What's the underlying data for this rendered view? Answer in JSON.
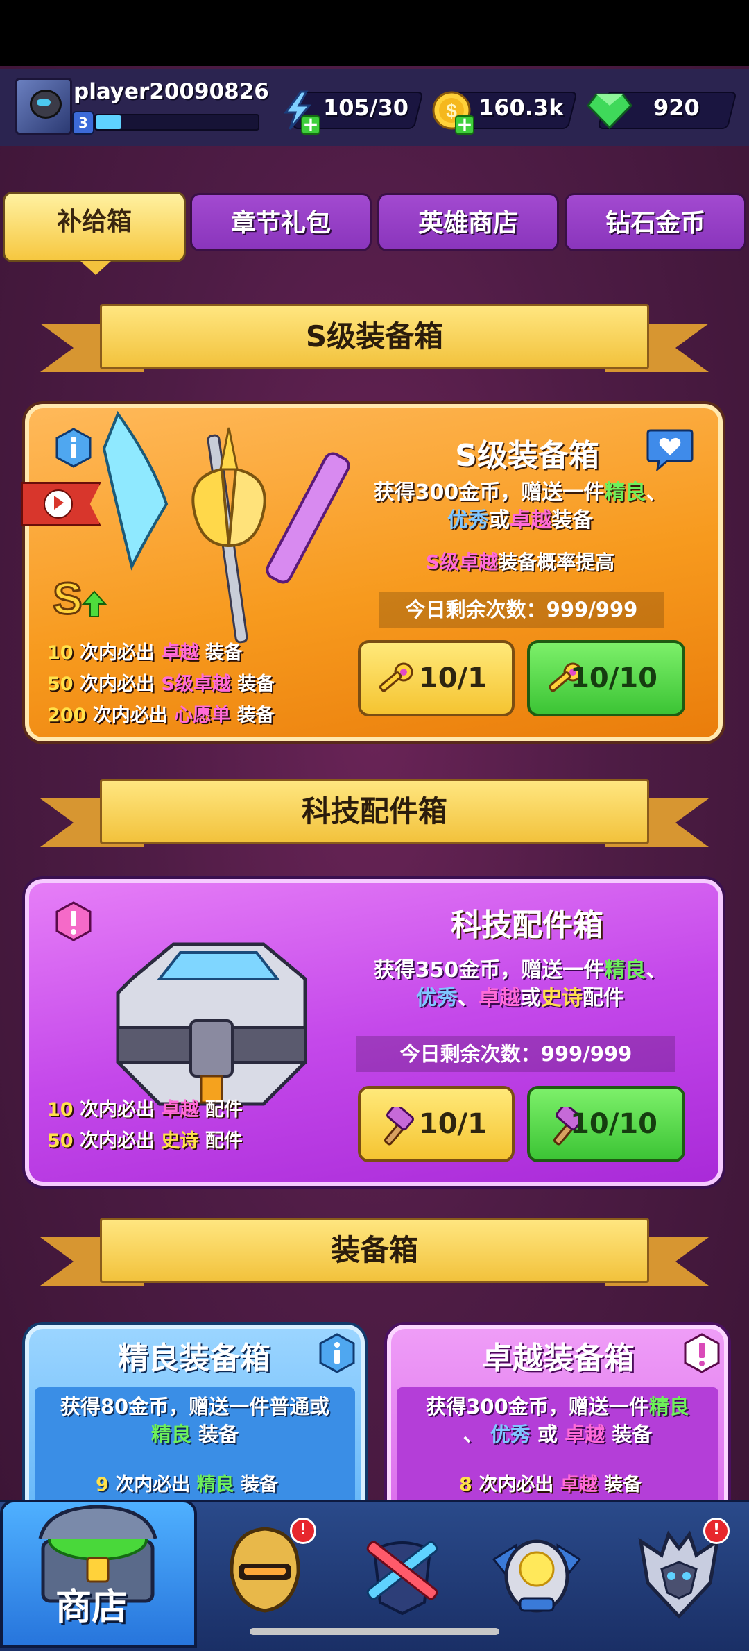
{
  "player": {
    "name": "player20090826",
    "level": "3",
    "xp_fraction": 0.16
  },
  "resources": {
    "energy": "105/30",
    "gold": "160.3k",
    "gems": "920"
  },
  "tabs": [
    {
      "label": "补给箱",
      "active": true
    },
    {
      "label": "章节礼包",
      "active": false
    },
    {
      "label": "英雄商店",
      "active": false
    },
    {
      "label": "钻石金币",
      "active": false
    }
  ],
  "sections": {
    "s_box_header": "S级装备箱",
    "tech_box_header": "科技配件箱",
    "equip_box_header": "装备箱"
  },
  "s_box": {
    "title": "S级装备箱",
    "desc_1": "获得300金币，赠送一件",
    "desc_q1": "精良",
    "desc_sep1": "、",
    "desc_q2": "优秀",
    "desc_or": "或",
    "desc_q3": "卓越",
    "desc_end": "装备",
    "rate_q": "S级卓越",
    "rate_end": "装备概率提高",
    "remaining": "今日剩余次数：999/999",
    "pity": [
      {
        "count": "10",
        "mid": "次内必出",
        "quality": "卓越",
        "end": "装备"
      },
      {
        "count": "50",
        "mid": "次内必出",
        "quality": "S级卓越",
        "end": "装备"
      },
      {
        "count": "200",
        "mid": "次内必出",
        "quality": "心愿单",
        "end": "装备"
      }
    ],
    "btn_single": "10/1",
    "btn_multi": "10/10"
  },
  "tech_box": {
    "title": "科技配件箱",
    "desc_1": "获得350金币，赠送一件",
    "desc_q1": "精良",
    "desc_sep1": "、",
    "desc_q2": "优秀",
    "desc_sep2": "、",
    "desc_q3": "卓越",
    "desc_or": "或",
    "desc_q4": "史诗",
    "desc_end": "配件",
    "remaining": "今日剩余次数：999/999",
    "pity": [
      {
        "count": "10",
        "mid": "次内必出",
        "quality": "卓越",
        "end": "配件"
      },
      {
        "count": "50",
        "mid": "次内必出",
        "quality": "史诗",
        "end": "配件"
      }
    ],
    "btn_single": "10/1",
    "btn_multi": "10/10"
  },
  "fine_box": {
    "title": "精良装备箱",
    "desc_1": "获得80金币，赠送一件普通或",
    "desc_q1": "精良",
    "desc_end": "装备",
    "pity_count": "9",
    "pity_mid": "次内必出",
    "pity_q": "精良",
    "pity_end": "装备"
  },
  "superb_box": {
    "title": "卓越装备箱",
    "desc_1": "获得300金币，赠送一件",
    "desc_q1": "精良",
    "desc_sep": "、",
    "desc_q2": "优秀",
    "desc_or": "或",
    "desc_q3": "卓越",
    "desc_end": "装备",
    "pity_count": "8",
    "pity_mid": "次内必出",
    "pity_q": "卓越",
    "pity_end": "装备"
  },
  "bottom_nav": {
    "shop_label": "商店",
    "badge": "!"
  },
  "colors": {
    "quality_fine": "#6ef05a",
    "quality_good": "#7fc6ff",
    "quality_superb": "#ff6bd8",
    "quality_epic": "#ffe14a"
  }
}
